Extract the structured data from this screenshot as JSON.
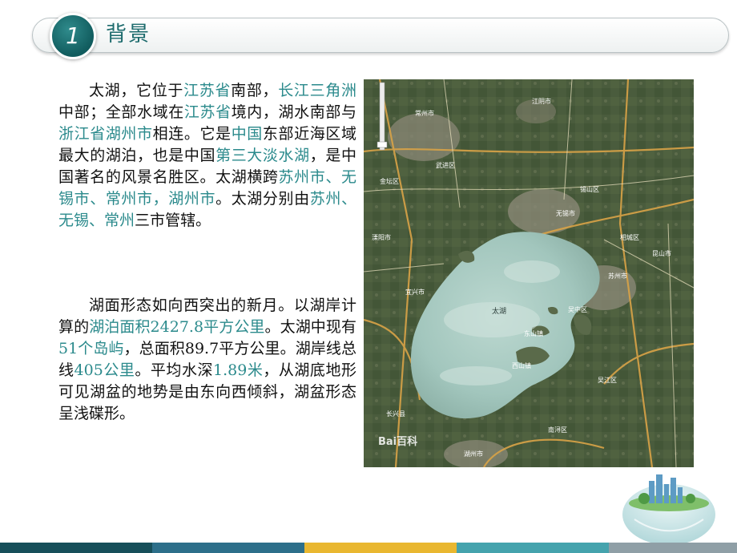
{
  "header": {
    "number": "1",
    "title": "背景"
  },
  "paragraph1": [
    {
      "t": "太湖，它位于",
      "h": false
    },
    {
      "t": "江苏省",
      "h": true
    },
    {
      "t": "南部，",
      "h": false
    },
    {
      "t": "长江三角洲",
      "h": true
    },
    {
      "t": "中部；全部水域在",
      "h": false
    },
    {
      "t": "江苏省",
      "h": true
    },
    {
      "t": "境内，湖水南部与",
      "h": false
    },
    {
      "t": "浙江省湖州市",
      "h": true
    },
    {
      "t": "相连。它是",
      "h": false
    },
    {
      "t": "中国",
      "h": true
    },
    {
      "t": "东部近海区域最大的湖泊，也是中国",
      "h": false
    },
    {
      "t": "第三大淡水湖",
      "h": true
    },
    {
      "t": "，是中国著名的风景名胜区。太湖横跨",
      "h": false
    },
    {
      "t": "苏州市、无锡市、常州市，湖州市",
      "h": true
    },
    {
      "t": "。太湖分别由",
      "h": false
    },
    {
      "t": "苏州、无锡、常州",
      "h": true
    },
    {
      "t": "三市管辖。",
      "h": false
    }
  ],
  "paragraph2": [
    {
      "t": "湖面形态如向西突出的新月。以湖岸计算的",
      "h": false
    },
    {
      "t": "湖泊面积2427.8平方公里",
      "h": true
    },
    {
      "t": "。太湖中现有",
      "h": false
    },
    {
      "t": "51个岛屿",
      "h": true
    },
    {
      "t": "，总面积89.7平方公里。湖岸线总线",
      "h": false
    },
    {
      "t": "405公里",
      "h": true
    },
    {
      "t": "。平均水深",
      "h": false
    },
    {
      "t": "1.89米",
      "h": true
    },
    {
      "t": "，从湖底地形可见湖盆的地势是由东向西倾斜，湖盆形态呈浅碟形。",
      "h": false
    }
  ],
  "map": {
    "lake_label": "太湖",
    "watermark": "Bai百科",
    "city_labels": [
      "常州市",
      "无锡市",
      "苏州市",
      "湖州市",
      "宜兴市",
      "吴江区",
      "长兴县",
      "武进区",
      "江阴市",
      "昆山市",
      "吴中区",
      "相城区",
      "东山镇",
      "西山镇",
      "南浔区",
      "溧阳市",
      "金坛区",
      "锡山区"
    ]
  },
  "colors": {
    "accent": "#1d6b6d",
    "highlight": "#2b8a8c",
    "lake": "#a9cbc3",
    "land": "#4d5f3e",
    "strip": [
      "#174f5a",
      "#2d6f8a",
      "#e9b730",
      "#45a3ad",
      "#8f9fa6"
    ]
  }
}
